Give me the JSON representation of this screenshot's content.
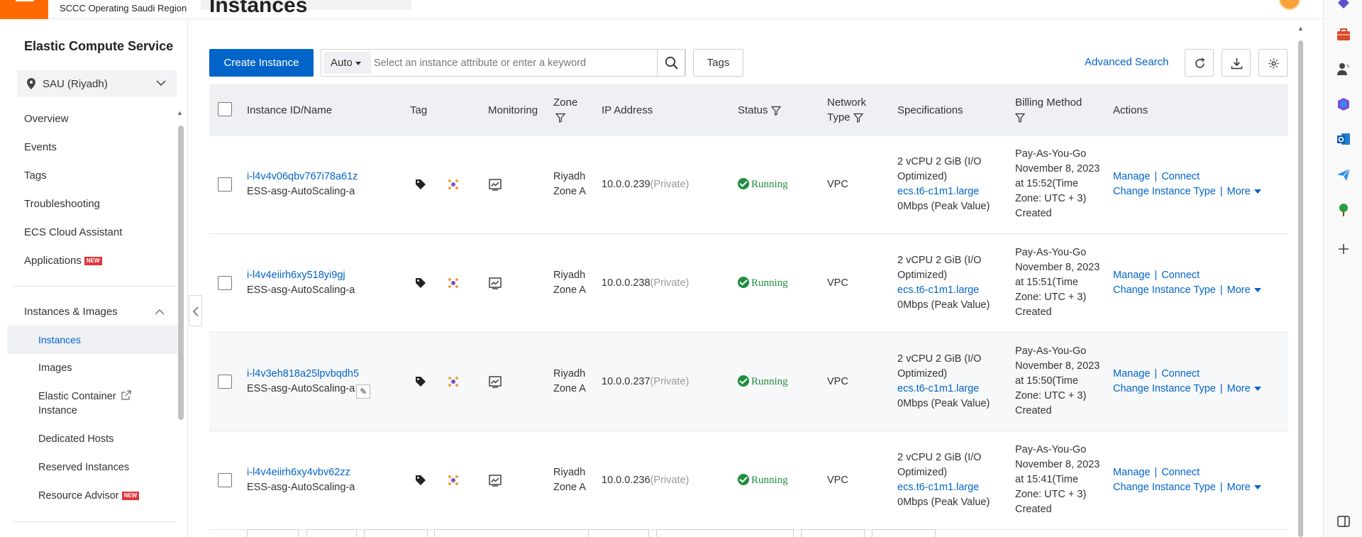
{
  "topbar": {
    "org_name": "SCCC Operating Saudi Region"
  },
  "page": {
    "title": "Instances"
  },
  "sidebar": {
    "title": "Elastic Compute Service",
    "region": "SAU (Riyadh)",
    "items": [
      {
        "label": "Overview"
      },
      {
        "label": "Events"
      },
      {
        "label": "Tags"
      },
      {
        "label": "Troubleshooting"
      },
      {
        "label": "ECS Cloud Assistant"
      },
      {
        "label": "Applications",
        "badge": "NEW"
      }
    ],
    "section": "Instances & Images",
    "sub_items": [
      {
        "label": "Instances",
        "active": true
      },
      {
        "label": "Images"
      },
      {
        "label": "Elastic Container Instance",
        "line1": "Elastic Container",
        "line2": "Instance"
      },
      {
        "label": "Dedicated Hosts"
      },
      {
        "label": "Reserved Instances"
      },
      {
        "label": "Resource Advisor",
        "badge": "NEW"
      }
    ]
  },
  "toolbar": {
    "create_label": "Create Instance",
    "search_mode": "Auto",
    "search_placeholder": "Select an instance attribute or enter a keyword",
    "tags_label": "Tags",
    "advanced_search": "Advanced Search"
  },
  "table": {
    "headers": {
      "id_name": "Instance ID/Name",
      "tag": "Tag",
      "monitoring": "Monitoring",
      "zone": "Zone",
      "ip": "IP Address",
      "status": "Status",
      "network_line1": "Network",
      "network_line2": "Type",
      "specs": "Specifications",
      "billing": "Billing Method",
      "actions": "Actions"
    },
    "rows": [
      {
        "id": "i-l4v4v06qbv767i78a61z",
        "name": "ESS-asg-AutoScaling-a",
        "zone_line1": "Riyadh",
        "zone_line2": "Zone A",
        "ip": "10.0.0.239",
        "ip_type": "(Private)",
        "status": "Running",
        "network": "VPC",
        "spec_line1": "2 vCPU 2 GiB   (I/O",
        "spec_line2": "Optimized)",
        "spec_type": "ecs.t6-c1m1.large",
        "bandwidth": "0Mbps (Peak Value)",
        "bill_1": "Pay-As-You-Go",
        "bill_2": "November 8, 2023",
        "bill_3": "at 15:52(Time",
        "bill_4": "Zone: UTC + 3)",
        "bill_5": "Created",
        "manage": "Manage",
        "connect": "Connect",
        "change_type": "Change Instance Type",
        "more": "More"
      },
      {
        "id": "i-l4v4eiirh6xy518yi9gj",
        "name": "ESS-asg-AutoScaling-a",
        "zone_line1": "Riyadh",
        "zone_line2": "Zone A",
        "ip": "10.0.0.238",
        "ip_type": "(Private)",
        "status": "Running",
        "network": "VPC",
        "spec_line1": "2 vCPU 2 GiB   (I/O",
        "spec_line2": "Optimized)",
        "spec_type": "ecs.t6-c1m1.large",
        "bandwidth": "0Mbps (Peak Value)",
        "bill_1": "Pay-As-You-Go",
        "bill_2": "November 8, 2023",
        "bill_3": "at 15:51(Time",
        "bill_4": "Zone: UTC + 3)",
        "bill_5": "Created",
        "manage": "Manage",
        "connect": "Connect",
        "change_type": "Change Instance Type",
        "more": "More"
      },
      {
        "id": "i-l4v3eh818a25lpvbqdh5",
        "name": "ESS-asg-AutoScaling-a",
        "zone_line1": "Riyadh",
        "zone_line2": "Zone A",
        "ip": "10.0.0.237",
        "ip_type": "(Private)",
        "status": "Running",
        "network": "VPC",
        "spec_line1": "2 vCPU 2 GiB   (I/O",
        "spec_line2": "Optimized)",
        "spec_type": "ecs.t6-c1m1.large",
        "bandwidth": "0Mbps (Peak Value)",
        "bill_1": "Pay-As-You-Go",
        "bill_2": "November 8, 2023",
        "bill_3": "at 15:50(Time",
        "bill_4": "Zone: UTC + 3)",
        "bill_5": "Created",
        "manage": "Manage",
        "connect": "Connect",
        "change_type": "Change Instance Type",
        "more": "More"
      },
      {
        "id": "i-l4v4eiirh6xy4vbv62zz",
        "name": "ESS-asg-AutoScaling-a",
        "zone_line1": "Riyadh",
        "zone_line2": "Zone A",
        "ip": "10.0.0.236",
        "ip_type": "(Private)",
        "status": "Running",
        "network": "VPC",
        "spec_line1": "2 vCPU 2 GiB   (I/O",
        "spec_line2": "Optimized)",
        "spec_type": "ecs.t6-c1m1.large",
        "bandwidth": "0Mbps (Peak Value)",
        "bill_1": "Pay-As-You-Go",
        "bill_2": "November 8, 2023",
        "bill_3": "at 15:41(Time",
        "bill_4": "Zone: UTC + 3)",
        "bill_5": "Created",
        "manage": "Manage",
        "connect": "Connect",
        "change_type": "Change Instance Type",
        "more": "More"
      }
    ]
  },
  "colors": {
    "accent": "#0064c8",
    "brand_orange": "#ff6a00",
    "running_green": "#1e8e3e",
    "badge_red": "#e0363b"
  },
  "icons": {
    "hamburger": "menu-icon",
    "search": "search-icon",
    "refresh": "refresh-icon",
    "download": "download-icon",
    "settings": "gear-icon",
    "tag": "tag-icon",
    "monitoring": "monitor-chart-icon",
    "filter": "filter-icon"
  }
}
